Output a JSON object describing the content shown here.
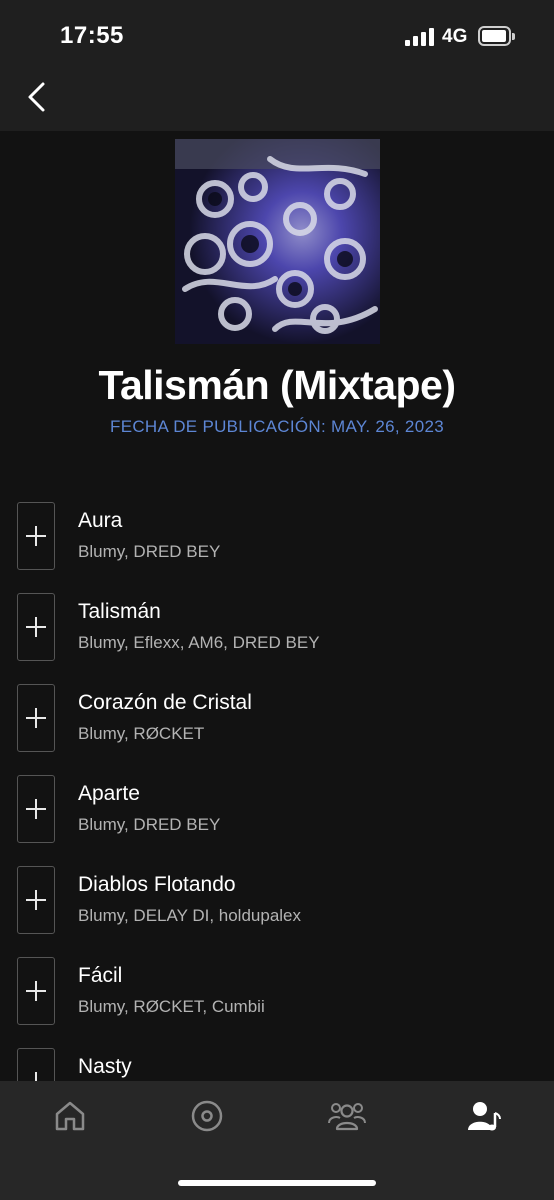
{
  "status_bar": {
    "time": "17:55",
    "network": "4G"
  },
  "album": {
    "title": "Talismán (Mixtape)",
    "release_date": "FECHA DE PUBLICACIÓN: MAY. 26, 2023"
  },
  "tracks": [
    {
      "title": "Aura",
      "artists": "Blumy, DRED BEY"
    },
    {
      "title": "Talismán",
      "artists": "Blumy, Eflexx, AM6, DRED BEY"
    },
    {
      "title": "Corazón de Cristal",
      "artists": "Blumy, RØCKET"
    },
    {
      "title": "Aparte",
      "artists": "Blumy, DRED BEY"
    },
    {
      "title": "Diablos Flotando",
      "artists": "Blumy, DELAY DI, holdupalex"
    },
    {
      "title": "Fácil",
      "artists": "Blumy, RØCKET, Cumbii"
    },
    {
      "title": "Nasty",
      "artists": ""
    }
  ],
  "tab_bar": {
    "items": [
      {
        "icon": "home-icon"
      },
      {
        "icon": "vinyl-icon"
      },
      {
        "icon": "friends-icon"
      },
      {
        "icon": "artist-profile-icon",
        "active": true
      }
    ]
  },
  "colors": {
    "background": "#121212",
    "header": "#1f1f1f",
    "tab_bar": "#272727",
    "accent_date": "#5d86d4",
    "text_secondary": "#b3b3b3"
  }
}
